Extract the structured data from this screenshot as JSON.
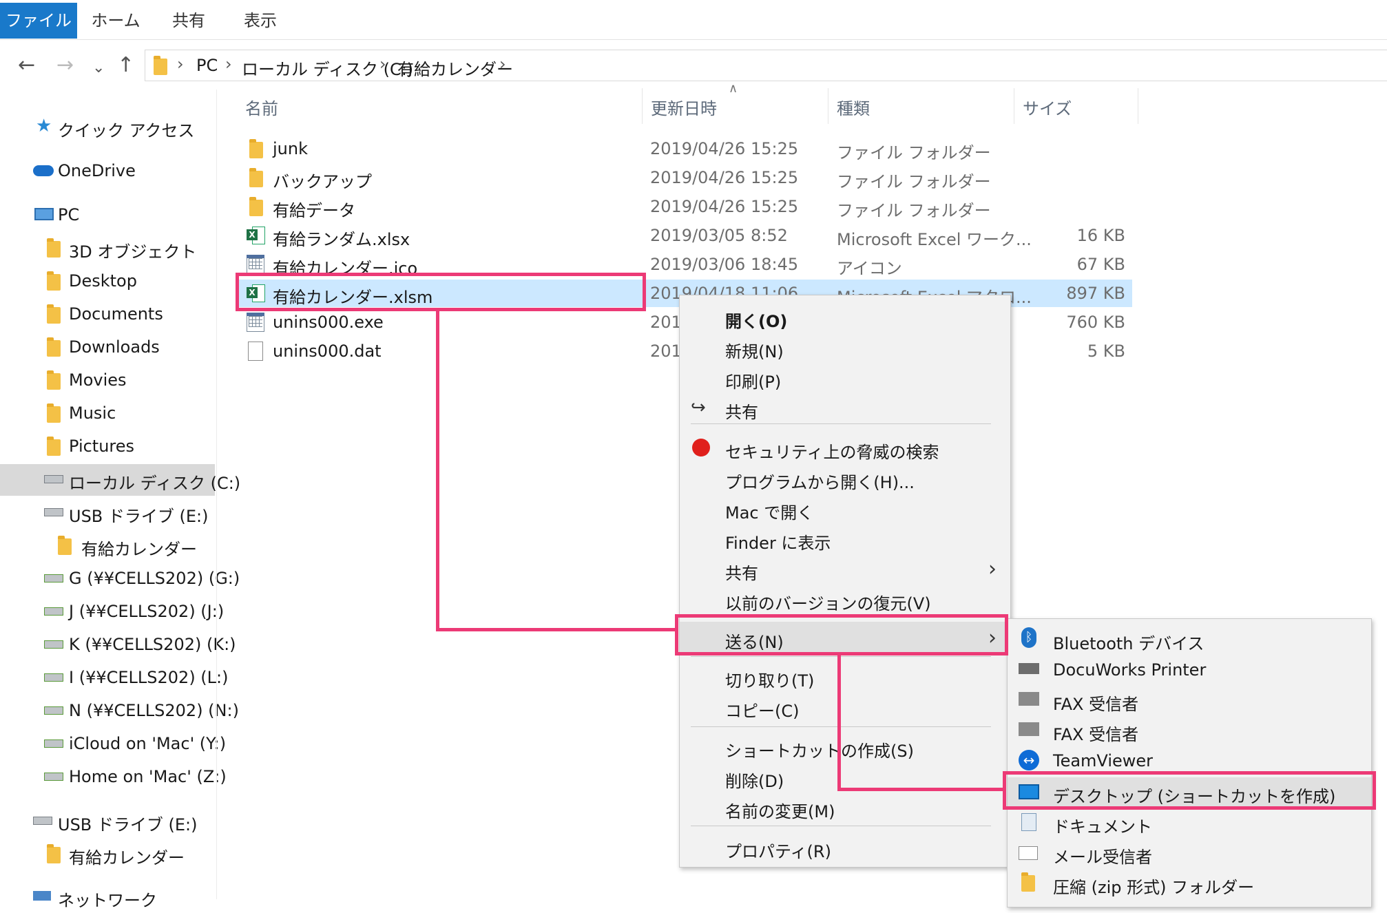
{
  "ribbon": {
    "tabs": [
      "ファイル",
      "ホーム",
      "共有",
      "表示"
    ]
  },
  "address": {
    "crumbs": [
      "PC",
      "ローカル ディスク (C:)",
      "有給カレンダー"
    ]
  },
  "sidebar": {
    "items": [
      "クイック アクセス",
      "OneDrive",
      "PC",
      "3D オブジェクト",
      "Desktop",
      "Documents",
      "Downloads",
      "Movies",
      "Music",
      "Pictures",
      "ローカル ディスク (C:)",
      "USB ドライブ (E:)",
      "有給カレンダー",
      "G (¥¥CELLS202) (G:)",
      "J (¥¥CELLS202) (J:)",
      "K (¥¥CELLS202) (K:)",
      "I (¥¥CELLS202) (L:)",
      "N (¥¥CELLS202) (N:)",
      "iCloud on 'Mac' (Y:)",
      "Home on 'Mac' (Z:)",
      "USB ドライブ (E:)",
      "有給カレンダー",
      "ネットワーク"
    ]
  },
  "columns": {
    "name": "名前",
    "date": "更新日時",
    "type": "種類",
    "size": "サイズ"
  },
  "files": [
    {
      "name": "junk",
      "date": "2019/04/26 15:25",
      "type": "ファイル フォルダー",
      "size": ""
    },
    {
      "name": "バックアップ",
      "date": "2019/04/26 15:25",
      "type": "ファイル フォルダー",
      "size": ""
    },
    {
      "name": "有給データ",
      "date": "2019/04/26 15:25",
      "type": "ファイル フォルダー",
      "size": ""
    },
    {
      "name": "有給ランダム.xlsx",
      "date": "2019/03/05 8:52",
      "type": "Microsoft Excel ワーク...",
      "size": "16 KB"
    },
    {
      "name": "有給カレンダー.ico",
      "date": "2019/03/06 18:45",
      "type": "アイコン",
      "size": "67 KB"
    },
    {
      "name": "有給カレンダー.xlsm",
      "date": "2019/04/18 11:06",
      "type": "Microsoft Excel マクロ...",
      "size": "897 KB"
    },
    {
      "name": "unins000.exe",
      "date": "2019",
      "type": "",
      "size": "760 KB"
    },
    {
      "name": "unins000.dat",
      "date": "2019",
      "type": "",
      "size": "5 KB"
    }
  ],
  "context_menu": {
    "items": [
      "開く(O)",
      "新規(N)",
      "印刷(P)",
      "共有",
      "セキュリティ上の脅威の検索",
      "プログラムから開く(H)...",
      "Mac で開く",
      "Finder に表示",
      "共有",
      "以前のバージョンの復元(V)",
      "送る(N)",
      "切り取り(T)",
      "コピー(C)",
      "ショートカットの作成(S)",
      "削除(D)",
      "名前の変更(M)",
      "プロパティ(R)"
    ]
  },
  "send_to_menu": {
    "items": [
      "Bluetooth デバイス",
      "DocuWorks Printer",
      "FAX 受信者",
      "FAX 受信者",
      "TeamViewer",
      "デスクトップ (ショートカットを作成)",
      "ドキュメント",
      "メール受信者",
      "圧縮 (zip 形式) フォルダー"
    ]
  },
  "colors": {
    "accent": "#1979ca",
    "highlight": "#ec3a76",
    "selection": "#cce8ff"
  }
}
